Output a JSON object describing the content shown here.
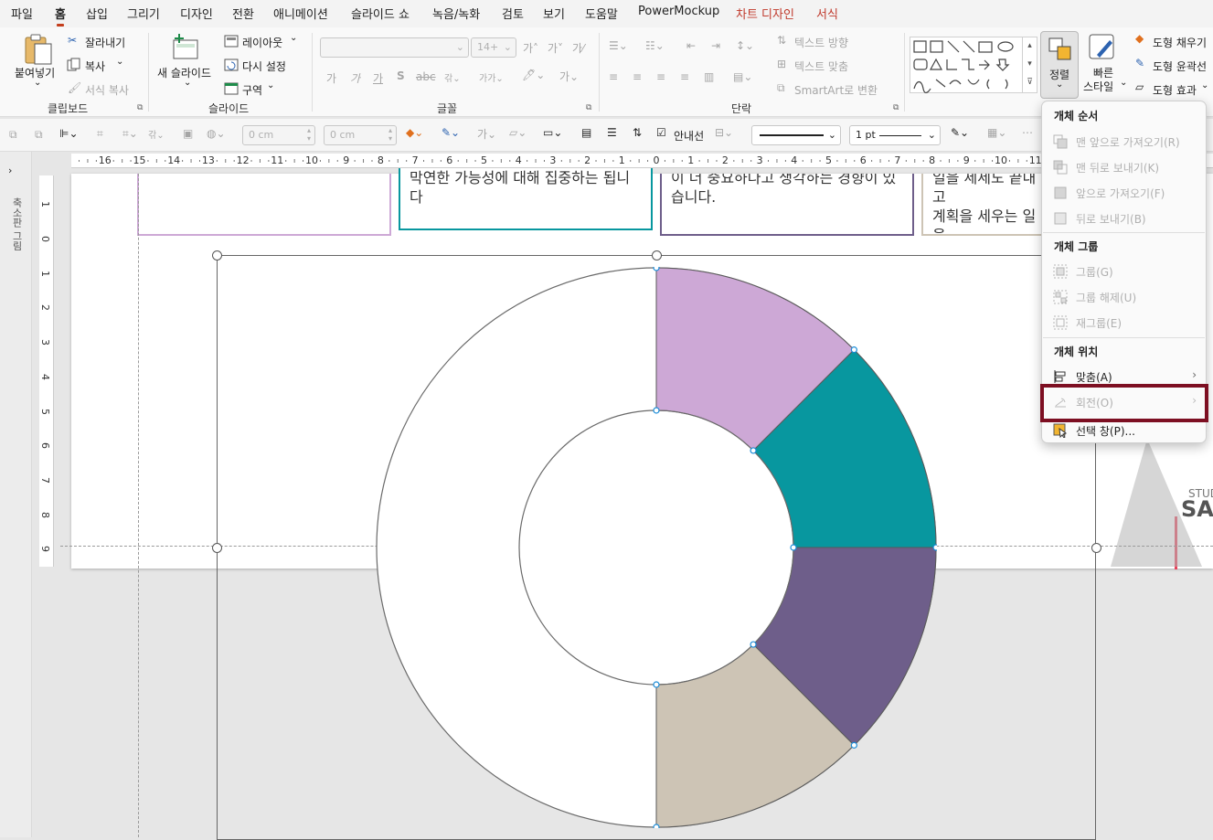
{
  "menubar": {
    "tabs": [
      "파일",
      "홈",
      "삽입",
      "그리기",
      "디자인",
      "전환",
      "애니메이션",
      "슬라이드 쇼",
      "녹음/녹화",
      "검토",
      "보기",
      "도움말",
      "PowerMockup",
      "차트 디자인",
      "서식"
    ]
  },
  "ribbon": {
    "clipboard": {
      "paste": "붙여넣기",
      "cut": "잘라내기",
      "copy": "복사",
      "format_painter": "서식 복사",
      "group": "클립보드"
    },
    "slides": {
      "new_slide": "새 슬라이드",
      "layout": "레이아웃",
      "reset": "다시 설정",
      "section": "구역",
      "group": "슬라이드"
    },
    "font": {
      "size": "14+",
      "group": "글꼴"
    },
    "paragraph": {
      "text_direction": "텍스트 방향",
      "align_text": "텍스트 맞춤",
      "smartart": "SmartArt로 변환",
      "group": "단락"
    },
    "arrange": {
      "label": "정렬"
    },
    "quick_styles": {
      "label1": "빠른",
      "label2": "스타일"
    },
    "shape_fill": "도형 채우기",
    "shape_outline": "도형 윤곽선",
    "shape_effects": "도형 효과"
  },
  "toolbar2": {
    "width_value": "0 cm",
    "height_value": "0 cm",
    "gridlines_label": "안내선",
    "line_weight": "1 pt"
  },
  "left_panel": {
    "label": "축소판 그림"
  },
  "hruler_labels": [
    "16",
    "15",
    "14",
    "13",
    "12",
    "11",
    "10",
    "9",
    "8",
    "7",
    "6",
    "5",
    "4",
    "3",
    "2",
    "1",
    "0",
    "1",
    "2",
    "3",
    "4",
    "5",
    "6",
    "7",
    "8",
    "9",
    "10",
    "11"
  ],
  "vruler_labels": [
    "1",
    "0",
    "1",
    "2",
    "3",
    "4",
    "5",
    "6",
    "7",
    "8",
    "9"
  ],
  "slide": {
    "cards": [
      {
        "text": ""
      },
      {
        "text": "막연한 가능성에 대해 집중하는 됩니다"
      },
      {
        "text": "이 더 중요하다고 생각하는 경향이 있습니다."
      },
      {
        "text": "일을 세세도 끝내고\n계획을 세우는 일을"
      }
    ],
    "brand_small": "STUD",
    "brand_big": "SAE"
  },
  "chart_data": {
    "type": "donut",
    "segments": [
      {
        "color": "#cda8d6",
        "start_deg": 0,
        "end_deg": 45
      },
      {
        "color": "#08979f",
        "start_deg": 45,
        "end_deg": 90
      },
      {
        "color": "#6e5e8a",
        "start_deg": 90,
        "end_deg": 135
      },
      {
        "color": "#cdc4b5",
        "start_deg": 135,
        "end_deg": 180
      }
    ],
    "empty_color": "#ffffff"
  },
  "arrange_menu": {
    "order_header": "개체 순서",
    "bring_front": "맨 앞으로 가져오기(R)",
    "send_back": "맨 뒤로 보내기(K)",
    "bring_forward": "앞으로 가져오기(F)",
    "send_backward": "뒤로 보내기(B)",
    "group_header": "개체 그룹",
    "group": "그룹(G)",
    "ungroup": "그룹 해제(U)",
    "regroup": "재그룹(E)",
    "position_header": "개체 위치",
    "align": "맞춤(A)",
    "rotate": "회전(O)",
    "selection_pane": "선택 창(P)..."
  },
  "colors": {
    "accent": "#c43e1c",
    "highlight": "#7d0f22"
  }
}
